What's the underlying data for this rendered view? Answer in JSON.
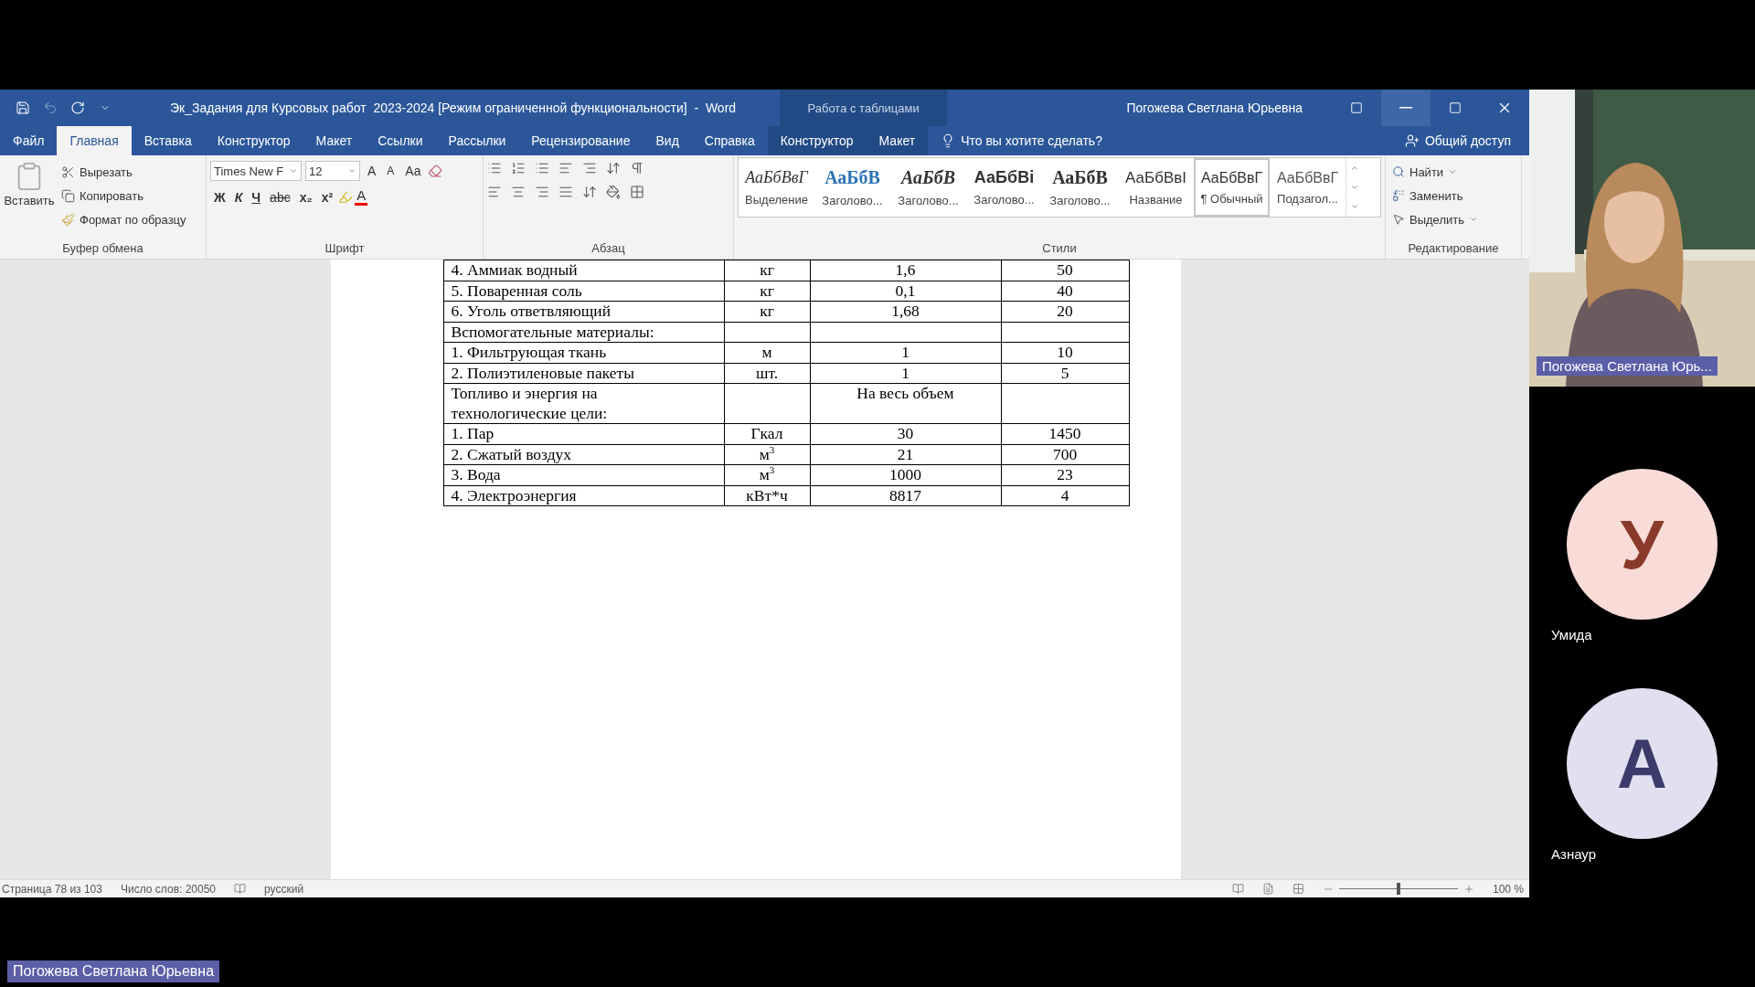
{
  "title_bar": {
    "document_title": "Эк_Задания для Курсовых работ  2023-2024 [Режим ограниченной функциональности]  -  Word",
    "contextual_group": "Работа с таблицами",
    "user": "Погожева Светлана Юрьевна"
  },
  "ribbon_tabs": [
    {
      "label": "Файл",
      "selected": false
    },
    {
      "label": "Главная",
      "selected": true
    },
    {
      "label": "Вставка",
      "selected": false
    },
    {
      "label": "Конструктор",
      "selected": false
    },
    {
      "label": "Макет",
      "selected": false
    },
    {
      "label": "Ссылки",
      "selected": false
    },
    {
      "label": "Рассылки",
      "selected": false
    },
    {
      "label": "Рецензирование",
      "selected": false
    },
    {
      "label": "Вид",
      "selected": false
    },
    {
      "label": "Справка",
      "selected": false
    }
  ],
  "table_tools_tabs": [
    {
      "label": "Конструктор",
      "selected": false
    },
    {
      "label": "Макет",
      "selected": false
    }
  ],
  "tell_me": "Что вы хотите сделать?",
  "share": "Общий доступ",
  "clipboard": {
    "paste": "Вставить",
    "cut": "Вырезать",
    "copy": "Копировать",
    "format_painter": "Формат по образцу",
    "group": "Буфер обмена"
  },
  "font": {
    "name": "Times New F",
    "size": "12",
    "grow": "A",
    "shrink": "A",
    "change_case": "Aa",
    "bold": "Ж",
    "italic": "К",
    "underline": "Ч",
    "strike": "abc",
    "subscript": "x₂",
    "superscript": "x²",
    "font_color": "A",
    "group": "Шрифт"
  },
  "paragraph": {
    "group": "Абзац"
  },
  "styles": {
    "group": "Стили",
    "items": [
      {
        "preview": "АаБбВвГ",
        "name": "Выделение",
        "kind": "emphasis",
        "selected": false
      },
      {
        "preview": "АаБбВ",
        "name": "Заголово...",
        "kind": "heading1",
        "selected": false
      },
      {
        "preview": "АаБбВ",
        "name": "Заголово...",
        "kind": "heading2",
        "selected": false
      },
      {
        "preview": "АаБбВі",
        "name": "Заголово...",
        "kind": "heading3",
        "selected": false
      },
      {
        "preview": "АаБбВ",
        "name": "Заголово...",
        "kind": "heading4",
        "selected": false
      },
      {
        "preview": "АаБбВвІ",
        "name": "Название",
        "kind": "title",
        "selected": false
      },
      {
        "preview": "АаБбВвГ",
        "name": "¶ Обычный",
        "kind": "normal",
        "selected": true
      },
      {
        "preview": "АаБбВвГ",
        "name": "Подзагол...",
        "kind": "subtitle",
        "selected": false
      }
    ]
  },
  "editing": {
    "group": "Редактирование",
    "find": "Найти",
    "replace": "Заменить",
    "select": "Выделить"
  },
  "table": {
    "rows": [
      {
        "name": "4. Аммиак водный",
        "unit": "кг",
        "qty": "1,6",
        "price": "50"
      },
      {
        "name": "5. Поваренная соль",
        "unit": "кг",
        "qty": "0,1",
        "price": "40"
      },
      {
        "name": "6. Уголь ответвляющий",
        "unit": "кг",
        "qty": "1,68",
        "price": "20"
      },
      {
        "name": "Вспомогательные материалы:"
      },
      {
        "name": "1. Фильтрующая ткань",
        "unit": "м",
        "qty": "1",
        "price": "10"
      },
      {
        "name": "2. Полиэтиленовые пакеты",
        "unit": "шт.",
        "qty": "1",
        "price": "5"
      },
      {
        "name": "Топливо и энергия на технологические цели:",
        "qty": "На весь объем"
      },
      {
        "name": "1. Пар",
        "unit": "Гкал",
        "qty": "30",
        "price": "1450"
      },
      {
        "name": "2. Сжатый воздух",
        "unit": "м$^{3}$",
        "qty": "21",
        "price": "700"
      },
      {
        "name": "3. Вода",
        "unit": "м$^{3}$",
        "qty": "1000",
        "price": "23"
      },
      {
        "name": "4. Электроэнергия",
        "unit": "кВт*ч",
        "qty": "8817",
        "price": "4"
      }
    ]
  },
  "status_bar": {
    "page": "Страница 78 из 103",
    "words": "Число слов: 20050",
    "language": "русский",
    "zoom": "100 %",
    "zoom_slider": {
      "level": 0.5
    }
  },
  "call": {
    "presenter": {
      "name_tag": "Погожева Светлана Юрь..."
    },
    "participants": [
      {
        "initial": "У",
        "name": "Умида",
        "color": "#f9dcd7"
      },
      {
        "initial": "А",
        "name": "Азнаур",
        "color": "#e1dff0"
      }
    ],
    "sharer_tag": "Погожева Светлана Юрьевна"
  }
}
